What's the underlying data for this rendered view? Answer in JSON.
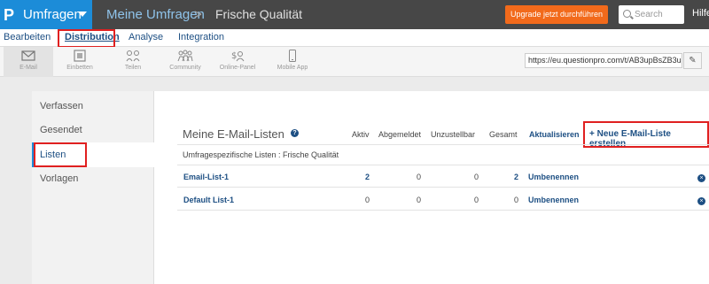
{
  "header": {
    "logo": "P",
    "app_menu": "Umfragen",
    "breadcrumb_root": "Meine Umfragen",
    "breadcrumb_sep": ">",
    "survey_name": "Frische Qualität",
    "upgrade_label": "Upgrade jetzt durchführen",
    "search_placeholder": "Search",
    "help_label": "Hilfe"
  },
  "tabs": [
    {
      "label": "Bearbeiten"
    },
    {
      "label": "Distribution"
    },
    {
      "label": "Analyse"
    },
    {
      "label": "Integration"
    }
  ],
  "toolbar": {
    "items": [
      {
        "label": "E-Mail",
        "icon": "envelope-icon"
      },
      {
        "label": "Einbetten",
        "icon": "embed-icon"
      },
      {
        "label": "Teilen",
        "icon": "share-icon"
      },
      {
        "label": "Community",
        "icon": "community-icon"
      },
      {
        "label": "Online-Panel",
        "icon": "panel-icon"
      },
      {
        "label": "Mobile App",
        "icon": "mobile-icon"
      }
    ],
    "survey_url": "https://eu.questionpro.com/t/AB3upBsZB3u"
  },
  "sidebar": {
    "items": [
      {
        "label": "Verfassen"
      },
      {
        "label": "Gesendet"
      },
      {
        "label": "Listen"
      },
      {
        "label": "Vorlagen"
      }
    ]
  },
  "lists": {
    "title": "Meine E-Mail-Listen",
    "help_icon": "?",
    "columns": [
      "Aktiv",
      "Abgemeldet",
      "Unzustellbar",
      "Gesamt"
    ],
    "refresh_label": "Aktualisieren",
    "new_list_label": "+ Neue E-Mail-Liste erstellen",
    "section_label": "Umfragespezifische Listen : Frische Qualität",
    "rows": [
      {
        "name": "Email-List-1",
        "aktiv": "2",
        "abgemeldet": "0",
        "unzustellbar": "0",
        "gesamt": "2",
        "action": "Umbenennen"
      },
      {
        "name": "Default List-1",
        "aktiv": "0",
        "abgemeldet": "0",
        "unzustellbar": "0",
        "gesamt": "0",
        "action": "Umbenennen"
      }
    ],
    "delete_symbol": "×"
  },
  "colors": {
    "brand_blue": "#1c8cd8",
    "topbar": "#474747",
    "upgrade_orange": "#f26a1b",
    "link_blue": "#1d4f83",
    "highlight_red": "#e02020"
  }
}
